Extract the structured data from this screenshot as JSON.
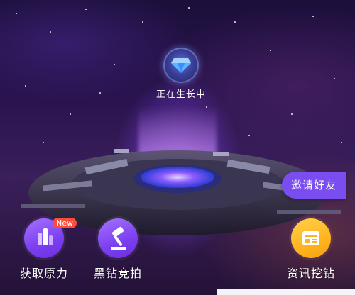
{
  "status": {
    "text": "正在生长中",
    "icon": "diamond-icon"
  },
  "invite": {
    "label": "邀请好友"
  },
  "actions": [
    {
      "label": "获取原力",
      "icon": "power-bars-icon",
      "badge": "New",
      "color": "#8a52f6"
    },
    {
      "label": "黑钻竞拍",
      "icon": "gavel-icon",
      "color": "#8a52f6"
    },
    {
      "label": "资讯挖钻",
      "icon": "news-icon",
      "color": "#ffbf2a"
    }
  ],
  "colors": {
    "accent": "#7a4df0",
    "badge": "#ff4a3b",
    "gold": "#ffbf2a"
  }
}
